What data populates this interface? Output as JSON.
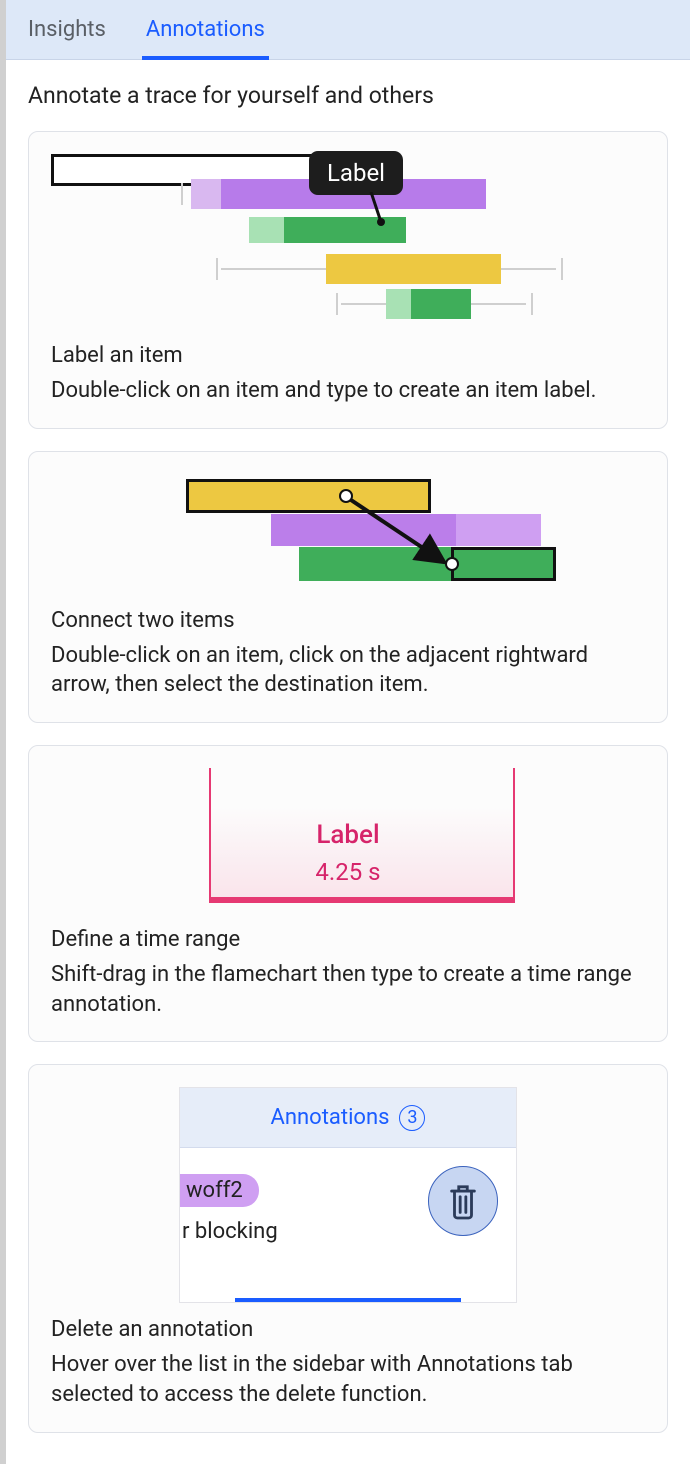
{
  "tabs": {
    "insights": "Insights",
    "annotations": "Annotations"
  },
  "header": {
    "title": "Annotate a trace for yourself and others"
  },
  "cards": {
    "label_item": {
      "tooltip": "Label",
      "title": "Label an item",
      "body": "Double-click on an item and type to create an item label."
    },
    "connect": {
      "title": "Connect two items",
      "body": "Double-click on an item, click on the adjacent rightward arrow, then select the destination item."
    },
    "time_range": {
      "label": "Label",
      "duration": "4.25 s",
      "title": "Define a time range",
      "body": "Shift-drag in the flamechart then type to create a time range annotation."
    },
    "delete": {
      "tab_label": "Annotations",
      "badge": "3",
      "pill": "woff2",
      "row_text": "r blocking",
      "title": "Delete an annotation",
      "body": "Hover over the list in the sidebar with Annotations tab selected to access the delete function."
    }
  }
}
